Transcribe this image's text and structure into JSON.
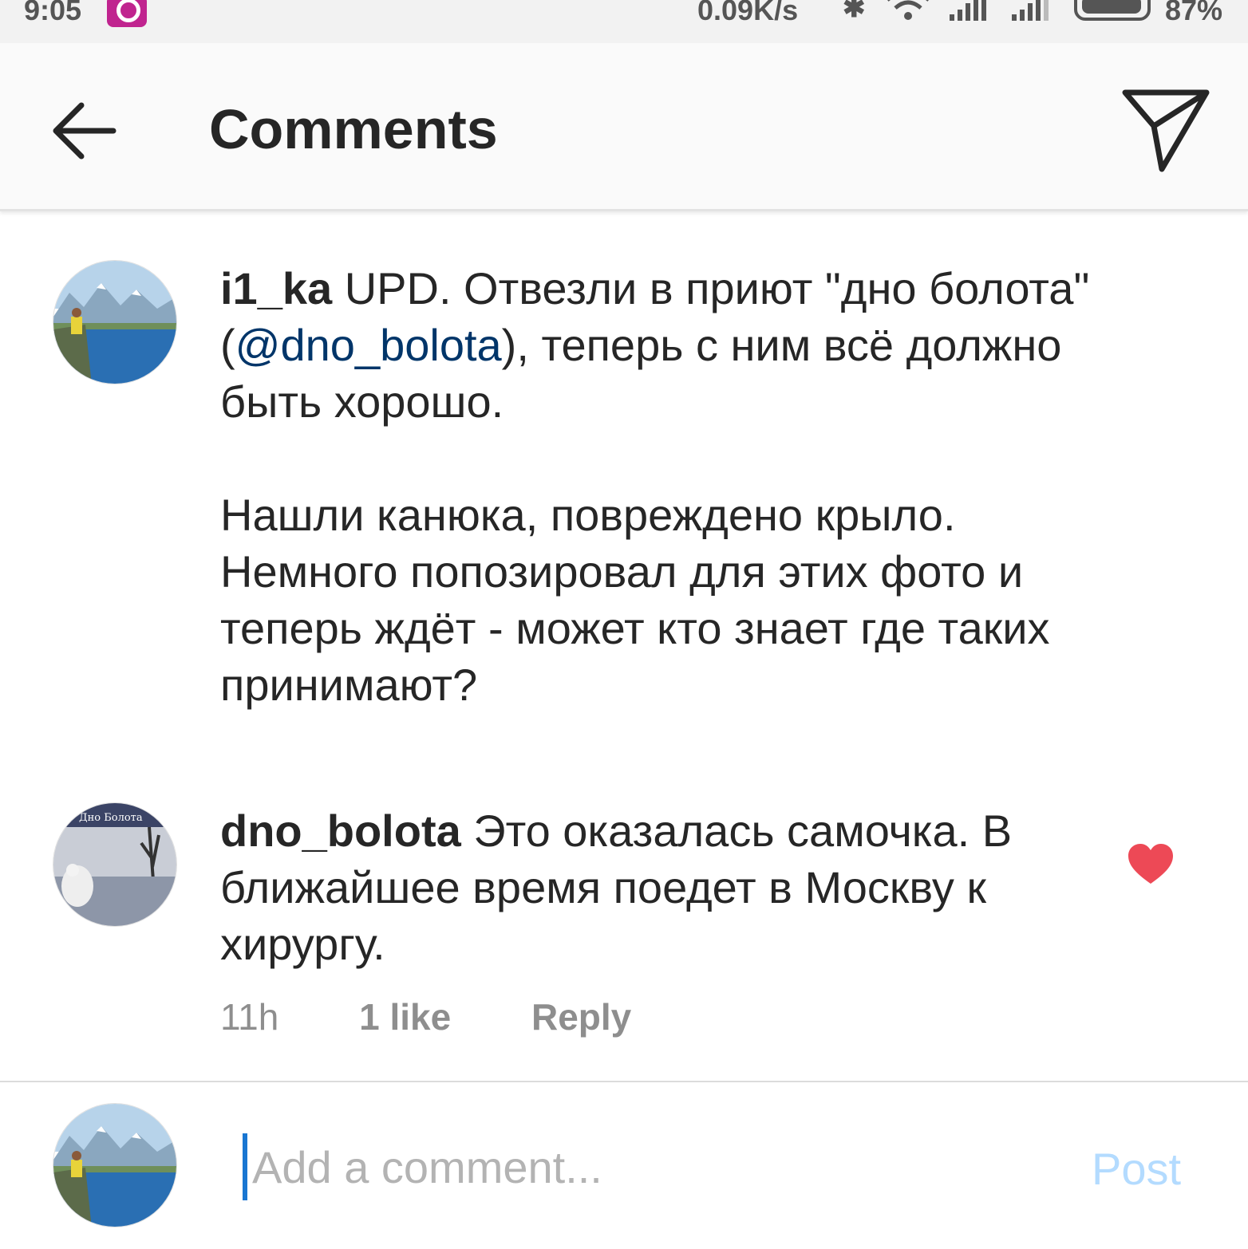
{
  "status_bar": {
    "time": "9:05",
    "speed": "0.09K/s",
    "battery": "87%",
    "icons": [
      "app-notification-icon",
      "bluetooth-icon",
      "wifi-icon",
      "signal-icon",
      "signal-icon",
      "battery-icon"
    ]
  },
  "header": {
    "title": "Comments",
    "back_icon": "arrow-left-icon",
    "share_icon": "paper-plane-icon"
  },
  "comments": [
    {
      "username": "i1_ka",
      "text_before_mention": "UPD. Отвезли в приют \"дно болота\" (",
      "mention": "@dno_bolota",
      "text_after_mention": "), теперь с ним всё должно быть хорошо.\n\nНашли канюка, повреждено крыло. Немного попозировал для этих фото и теперь ждёт - может кто знает где таких принимают?"
    },
    {
      "username": "dno_bolota",
      "avatar_text": "Дно Болота",
      "text": "Это оказалась самочка. В ближайшее время поедет в Москву к хирургу.",
      "time": "11h",
      "likes": "1 like",
      "reply": "Reply",
      "liked": true,
      "heart_color": "#ed4956"
    }
  ],
  "composer": {
    "placeholder": "Add a comment...",
    "post": "Post"
  },
  "colors": {
    "mention": "#003569",
    "heart": "#ed4956",
    "post_disabled": "#b3dbff",
    "cursor": "#1976d2"
  }
}
